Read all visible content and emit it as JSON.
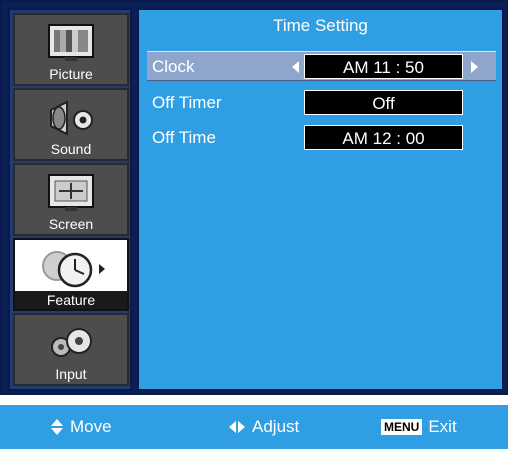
{
  "sidebar": {
    "items": [
      {
        "label": "Picture",
        "icon": "tv-picture-icon",
        "active": false
      },
      {
        "label": "Sound",
        "icon": "speaker-icon",
        "active": false
      },
      {
        "label": "Screen",
        "icon": "screen-adjust-icon",
        "active": false
      },
      {
        "label": "Feature",
        "icon": "clock-icon",
        "active": true
      },
      {
        "label": "Input",
        "icon": "input-gears-icon",
        "active": false
      }
    ]
  },
  "panel": {
    "title": "Time Setting",
    "rows": [
      {
        "label": "Clock",
        "value": "AM 11 : 50",
        "selected": true
      },
      {
        "label": "Off Timer",
        "value": "Off",
        "selected": false
      },
      {
        "label": "Off Time",
        "value": "AM 12 : 00",
        "selected": false
      }
    ]
  },
  "footer": {
    "move": "Move",
    "adjust": "Adjust",
    "menu_badge": "MENU",
    "exit": "Exit"
  },
  "colors": {
    "panel": "#2f9ee2",
    "sidebar_item": "#4d4d4d",
    "selected_row": "#8fa6cc"
  }
}
